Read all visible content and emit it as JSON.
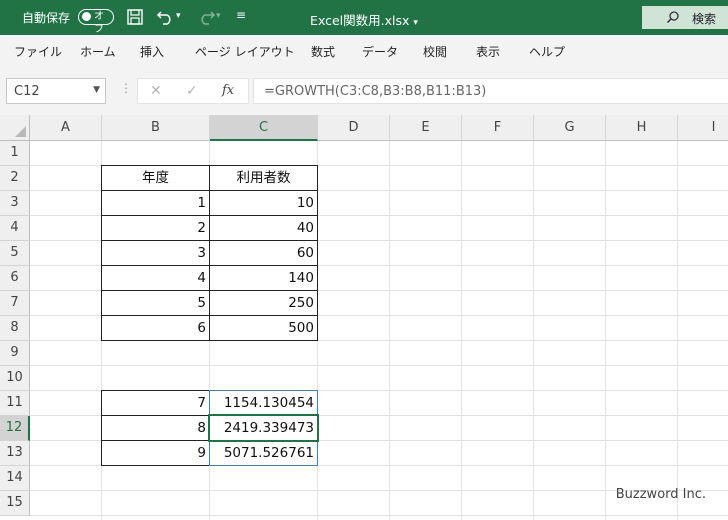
{
  "titlebar": {
    "autosave_label": "自動保存",
    "autosave_state": "オフ",
    "doc_title": "Excel関数用.xlsx",
    "search_label": "検索",
    "bg": "#217346"
  },
  "menu": [
    "ファイル",
    "ホーム",
    "挿入",
    "ページ レイアウト",
    "数式",
    "データ",
    "校閲",
    "表示",
    "ヘルプ"
  ],
  "formula_bar": {
    "name_box": "C12",
    "formula": "=GROWTH(C3:C8,B3:B8,B11:B13)"
  },
  "sheet": {
    "columns": [
      "A",
      "B",
      "C",
      "D",
      "E",
      "F",
      "G",
      "H",
      "I"
    ],
    "rows": [
      "1",
      "2",
      "3",
      "4",
      "5",
      "6",
      "7",
      "8",
      "9",
      "10",
      "11",
      "12",
      "13",
      "14",
      "15"
    ],
    "selected_column": "C",
    "selected_row": "12",
    "header_year": "年度",
    "header_users": "利用者数",
    "data": [
      {
        "year": "1",
        "users": "10"
      },
      {
        "year": "2",
        "users": "40"
      },
      {
        "year": "3",
        "users": "60"
      },
      {
        "year": "4",
        "users": "140"
      },
      {
        "year": "5",
        "users": "250"
      },
      {
        "year": "6",
        "users": "500"
      }
    ],
    "forecast": [
      {
        "year": "7",
        "value": "1154.130454"
      },
      {
        "year": "8",
        "value": "2419.339473"
      },
      {
        "year": "9",
        "value": "5071.526761"
      }
    ],
    "accent": "#217346"
  },
  "watermark": "Buzzword Inc."
}
